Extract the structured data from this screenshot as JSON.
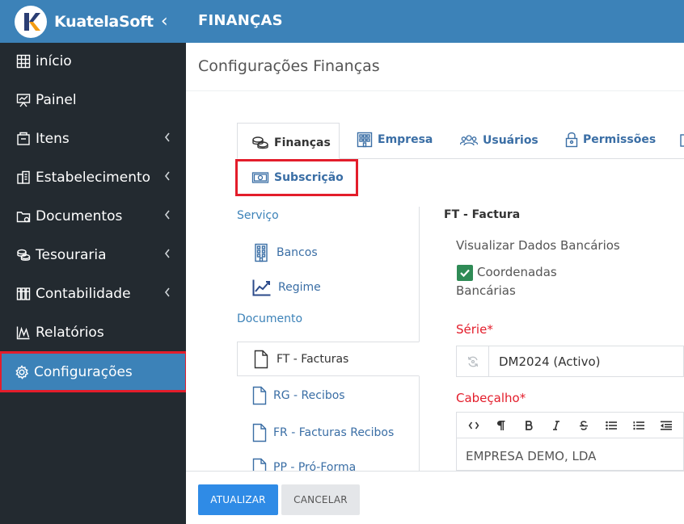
{
  "brand": {
    "name": "KuatelaSoft",
    "collapse_glyph": "‹",
    "logo_letter": "K",
    "logo_color": "#2b3e74",
    "logo_accent": "#f39c12"
  },
  "header": {
    "title": "FINANÇAS"
  },
  "page": {
    "title": "Configurações Finanças"
  },
  "sidebar": {
    "items": [
      {
        "label": "início",
        "icon": "grid-icon",
        "has_children": false
      },
      {
        "label": "Painel",
        "icon": "presentation-board-icon",
        "has_children": false
      },
      {
        "label": "Itens",
        "icon": "box-icon",
        "has_children": true
      },
      {
        "label": "Estabelecimento",
        "icon": "building-icon",
        "has_children": true
      },
      {
        "label": "Documentos",
        "icon": "folder-icon",
        "has_children": true
      },
      {
        "label": "Tesouraria",
        "icon": "coins-icon",
        "has_children": true
      },
      {
        "label": "Contabilidade",
        "icon": "binders-icon",
        "has_children": true
      },
      {
        "label": "Relatórios",
        "icon": "chart-icon",
        "has_children": false
      },
      {
        "label": "Configurações",
        "icon": "gear-icon",
        "has_children": false,
        "active": true
      }
    ]
  },
  "tabs": {
    "financas": "Finanças",
    "empresa": "Empresa",
    "usuarios": "Usuários",
    "permissoes": "Permissões",
    "subscricao": "Subscrição"
  },
  "menu": {
    "servico_label": "Serviço",
    "bancos": "Bancos",
    "regime": "Regime",
    "documento_label": "Documento",
    "ft": "FT - Facturas",
    "rg": "RG - Recibos",
    "fr": "FR - Facturas Recibos",
    "pp": "PP - Pró-Forma"
  },
  "form": {
    "title": "FT - Factura",
    "bank_data_label": "Visualizar Dados Bancários",
    "coords_label_line1": "Coordenadas",
    "coords_label_line2": "Bancárias",
    "coords_checked": true,
    "serie_label": "Série*",
    "serie_value": "DM2024 (Activo)",
    "cabecalho_label": "Cabeçalho*",
    "cabecalho_value": "EMPRESA DEMO, LDA"
  },
  "footer": {
    "update": "ATUALIZAR",
    "cancel": "CANCELAR"
  },
  "colors": {
    "primary": "#3c82b8",
    "sidebar": "#232a30",
    "highlight": "#e31d2b",
    "check": "#2f8b56",
    "button": "#2f8be6"
  }
}
